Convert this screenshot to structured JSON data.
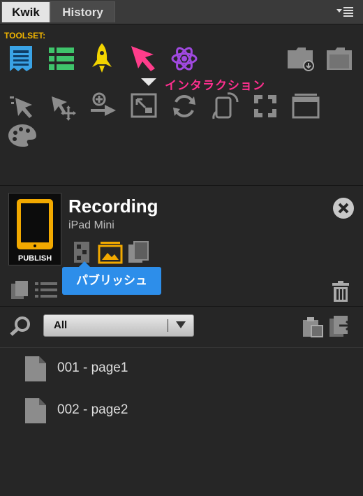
{
  "tabs": [
    {
      "label": "Kwik",
      "active": true
    },
    {
      "label": "History",
      "active": false
    }
  ],
  "toolset": {
    "label": "TOOLSET:",
    "hover_tooltip": "インタラクション"
  },
  "project": {
    "name": "Recording",
    "device": "iPad Mini",
    "publish_label": "PUBLISH",
    "publish_tooltip": "パブリッシュ"
  },
  "filter": {
    "selected": "All"
  },
  "pages": [
    {
      "label": "001 - page1"
    },
    {
      "label": "002 - page2"
    }
  ],
  "colors": {
    "accent_orange": "#f0b400",
    "tooltip_pink": "#ff2f8f",
    "publish_blue": "#2d8eea",
    "panel_bg": "#262626"
  },
  "icons": {
    "toolset_row": [
      "document-icon",
      "list-grid-icon",
      "rocket-icon",
      "pointer-arrow-icon",
      "atom-icon"
    ],
    "header_right": [
      "folder-add-icon",
      "folder-icon"
    ],
    "tools_row1": [
      "pointer-select-icon",
      "move-pointer-icon",
      "add-action-icon",
      "resize-icon",
      "refresh-icon",
      "rotate-device-icon",
      "fullscreen-icon",
      "window-icon"
    ],
    "tools_row2": [
      "palette-icon"
    ]
  }
}
